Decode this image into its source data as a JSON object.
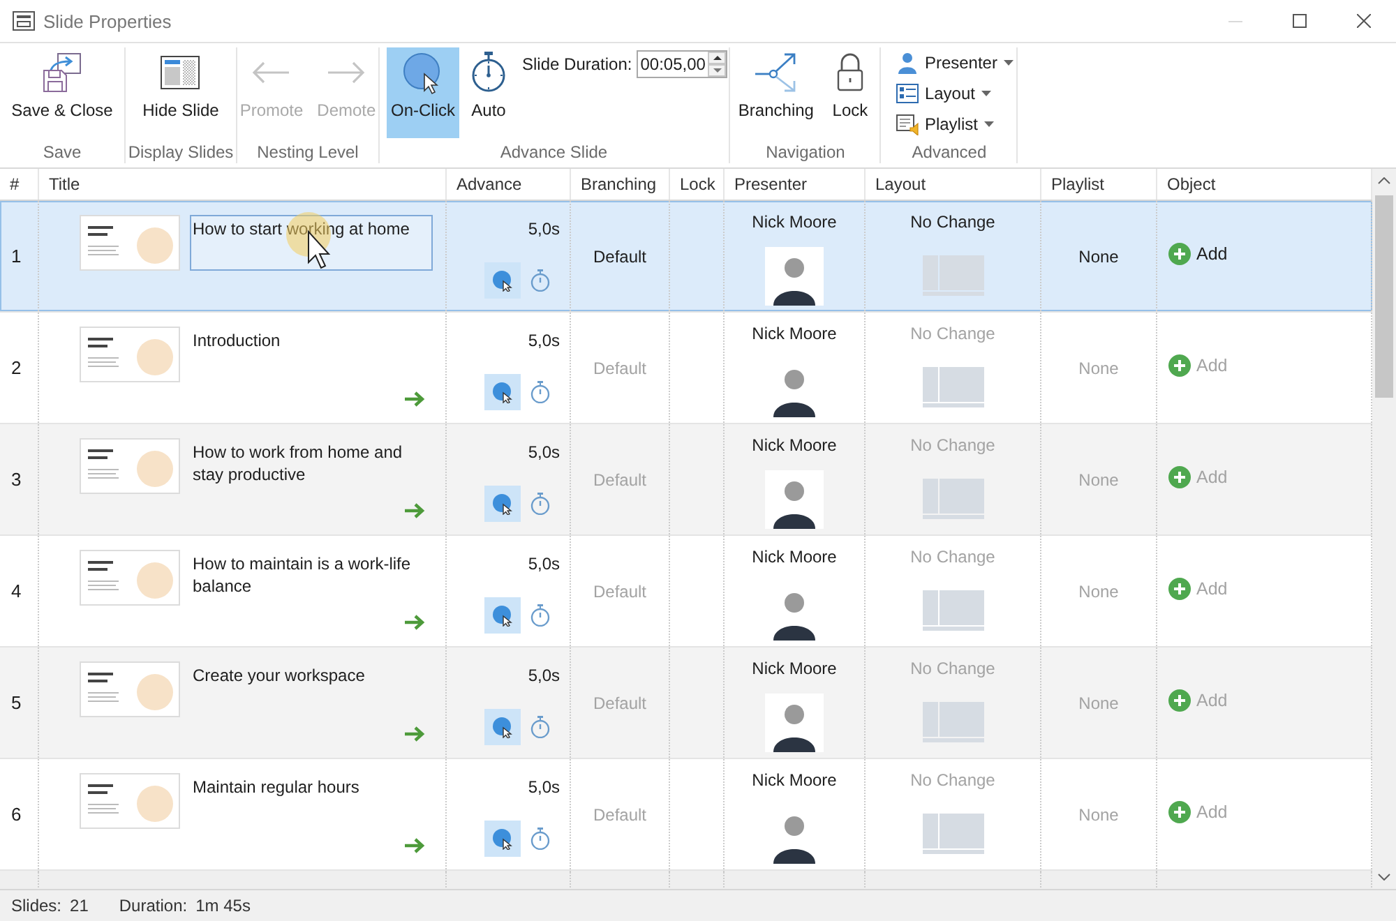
{
  "window": {
    "title": "Slide Properties",
    "controls": [
      {
        "kind": "minimize",
        "disabled": true
      },
      {
        "kind": "maximize",
        "disabled": false
      },
      {
        "kind": "close",
        "disabled": false
      }
    ]
  },
  "ribbon": [
    {
      "label": "Save",
      "buttons": [
        {
          "kind": "save",
          "label": "Save & Close",
          "disabled": false
        }
      ]
    },
    {
      "label": "Display Slides",
      "buttons": [
        {
          "kind": "hide",
          "label": "Hide Slide",
          "disabled": false
        }
      ]
    },
    {
      "label": "Nesting Level",
      "buttons": [
        {
          "kind": "promote",
          "label": "Promote",
          "disabled": true
        },
        {
          "kind": "demote",
          "label": "Demote",
          "disabled": true
        }
      ]
    },
    {
      "label": "Advance Slide",
      "buttons": [
        {
          "kind": "on-click",
          "label": "On-Click",
          "selected": true
        },
        {
          "kind": "auto",
          "label": "Auto",
          "selected": false
        }
      ],
      "duration": {
        "label": "Slide Duration:",
        "value": "00:05,00"
      }
    },
    {
      "label": "Navigation",
      "buttons": [
        {
          "kind": "branching",
          "label": "Branching",
          "disabled": false
        },
        {
          "kind": "lock",
          "label": "Lock",
          "disabled": false
        }
      ]
    },
    {
      "label": "Advanced",
      "menus": [
        {
          "kind": "presenter",
          "label": "Presenter"
        },
        {
          "kind": "layout",
          "label": "Layout"
        },
        {
          "kind": "playlist",
          "label": "Playlist"
        }
      ]
    }
  ],
  "table": {
    "columns": [
      "#",
      "Title",
      "Advance",
      "Branching",
      "Lock",
      "Presenter",
      "Layout",
      "Playlist",
      "Object"
    ],
    "rows": [
      {
        "number": "1",
        "title": "How to start working at home",
        "selected": true,
        "editing": true,
        "demoted": false,
        "duration": "5,0s",
        "advance_modes": [
          {
            "kind": "on-click",
            "selected": true
          },
          {
            "kind": "auto",
            "selected": false
          }
        ],
        "branching": "Default",
        "presenter": "Nick Moore",
        "layout": "No Change",
        "playlist": "None",
        "object": "Add"
      },
      {
        "number": "2",
        "title": "Introduction",
        "selected": false,
        "editing": false,
        "demoted": true,
        "duration": "5,0s",
        "advance_modes": [
          {
            "kind": "on-click",
            "selected": true
          },
          {
            "kind": "auto",
            "selected": false
          }
        ],
        "branching": "Default",
        "presenter": "Nick Moore",
        "layout": "No Change",
        "playlist": "None",
        "object": "Add"
      },
      {
        "number": "3",
        "title": "How to work from home and stay productive",
        "selected": false,
        "editing": false,
        "demoted": true,
        "duration": "5,0s",
        "advance_modes": [
          {
            "kind": "on-click",
            "selected": true
          },
          {
            "kind": "auto",
            "selected": false
          }
        ],
        "branching": "Default",
        "presenter": "Nick Moore",
        "layout": "No Change",
        "playlist": "None",
        "object": "Add"
      },
      {
        "number": "4",
        "title": "How to maintain is a work-life balance",
        "selected": false,
        "editing": false,
        "demoted": true,
        "duration": "5,0s",
        "advance_modes": [
          {
            "kind": "on-click",
            "selected": true
          },
          {
            "kind": "auto",
            "selected": false
          }
        ],
        "branching": "Default",
        "presenter": "Nick Moore",
        "layout": "No Change",
        "playlist": "None",
        "object": "Add"
      },
      {
        "number": "5",
        "title": "Create your workspace",
        "selected": false,
        "editing": false,
        "demoted": true,
        "duration": "5,0s",
        "advance_modes": [
          {
            "kind": "on-click",
            "selected": true
          },
          {
            "kind": "auto",
            "selected": false
          }
        ],
        "branching": "Default",
        "presenter": "Nick Moore",
        "layout": "No Change",
        "playlist": "None",
        "object": "Add"
      },
      {
        "number": "6",
        "title": "Maintain regular hours",
        "selected": false,
        "editing": false,
        "demoted": true,
        "duration": "5,0s",
        "advance_modes": [
          {
            "kind": "on-click",
            "selected": true
          },
          {
            "kind": "auto",
            "selected": false
          }
        ],
        "branching": "Default",
        "presenter": "Nick Moore",
        "layout": "No Change",
        "playlist": "None",
        "object": "Add"
      }
    ]
  },
  "status_bar": [
    {
      "label": "Slides:",
      "value": "21"
    },
    {
      "label": "Duration:",
      "value": "1m 45s"
    }
  ]
}
